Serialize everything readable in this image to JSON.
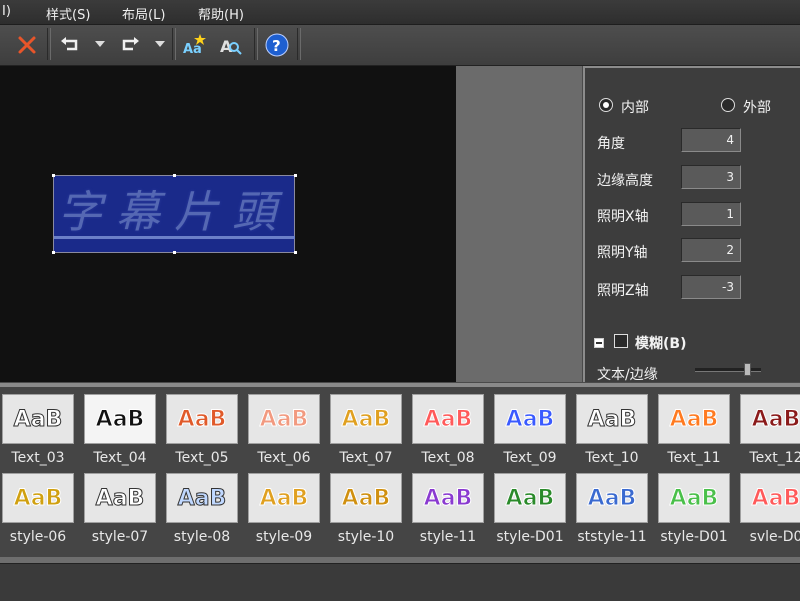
{
  "menu": {
    "partial_item": "I)",
    "items": [
      "样式(S)",
      "布局(L)",
      "帮助(H)"
    ]
  },
  "toolbar": {
    "icons": [
      "close-icon",
      "undo-icon",
      "redo-icon",
      "add-style-icon",
      "text-style-icon",
      "help-icon"
    ]
  },
  "preview": {
    "title_text": "字幕片頭"
  },
  "panel": {
    "inner_label": "内部",
    "outer_label": "外部",
    "angle_label": "角度",
    "angle_value": "4",
    "edge_height_label": "边缘高度",
    "edge_height_value": "3",
    "light_x_label": "照明X轴",
    "light_x_value": "1",
    "light_y_label": "照明Y轴",
    "light_y_value": "2",
    "light_z_label": "照明Z轴",
    "light_z_value": "-3",
    "blur_label": "模糊(B)",
    "text_edge_label": "文本/边缘"
  },
  "gallery": {
    "row1": [
      "Text_03",
      "Text_04",
      "Text_05",
      "Text_06",
      "Text_07",
      "Text_08",
      "Text_09",
      "Text_10",
      "Text_11",
      "Text_12"
    ],
    "row2": [
      "style-06",
      "style-07",
      "style-08",
      "style-09",
      "style-10",
      "style-11",
      "style-D01",
      "ststyle-11",
      "style-D01",
      "svle-D0"
    ],
    "sample_text": "AaB",
    "row1_colors": [
      "#ffffff",
      "#111111",
      "#e05a2a",
      "#f29a80",
      "#e0a020",
      "#ff5a5a",
      "#3a5aff",
      "#ffffff",
      "#ff7a20",
      "#8a1a1a"
    ],
    "row2_colors": [
      "#d0a010",
      "#ffffff",
      "#c0d8ff",
      "#e0a020",
      "#d09010",
      "#8a3ad0",
      "#2a8a2a",
      "#3a6ad0",
      "#4ac04a",
      "#ff5a5a"
    ]
  }
}
